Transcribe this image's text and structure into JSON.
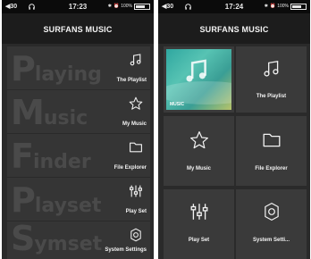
{
  "left_screen": {
    "status": {
      "signal": "◀30",
      "time": "17:23",
      "battery_pct": "100%"
    },
    "title": "SURFANS MUSIC",
    "items": [
      {
        "watermark_big": "P",
        "watermark_tail": "laying",
        "label": "The Playlist",
        "icon": "music-note-icon"
      },
      {
        "watermark_big": "M",
        "watermark_tail": "usic",
        "label": "My Music",
        "icon": "star-icon"
      },
      {
        "watermark_big": "F",
        "watermark_tail": "inder",
        "label": "File Explorer",
        "icon": "folder-icon"
      },
      {
        "watermark_big": "P",
        "watermark_tail": "layset",
        "label": "Play Set",
        "icon": "sliders-icon"
      },
      {
        "watermark_big": "S",
        "watermark_tail": "ymset",
        "label": "System Settings",
        "icon": "gear-icon"
      }
    ]
  },
  "right_screen": {
    "status": {
      "signal": "◀30",
      "time": "17:24",
      "battery_pct": "100%"
    },
    "title": "SURFANS MUSIC",
    "tiles": [
      {
        "label": "MUSIC",
        "icon": "album-art-icon"
      },
      {
        "label": "The Playlist",
        "icon": "music-note-icon"
      },
      {
        "label": "My Music",
        "icon": "star-icon"
      },
      {
        "label": "File Explorer",
        "icon": "folder-icon"
      },
      {
        "label": "Play Set",
        "icon": "sliders-icon"
      },
      {
        "label": "System Setti...",
        "icon": "gear-icon"
      }
    ]
  },
  "colors": {
    "background": "#2a2a2a",
    "tile": "#3a3a3a",
    "text": "#f2f2f2",
    "accent_art": "#2fa7a0"
  }
}
